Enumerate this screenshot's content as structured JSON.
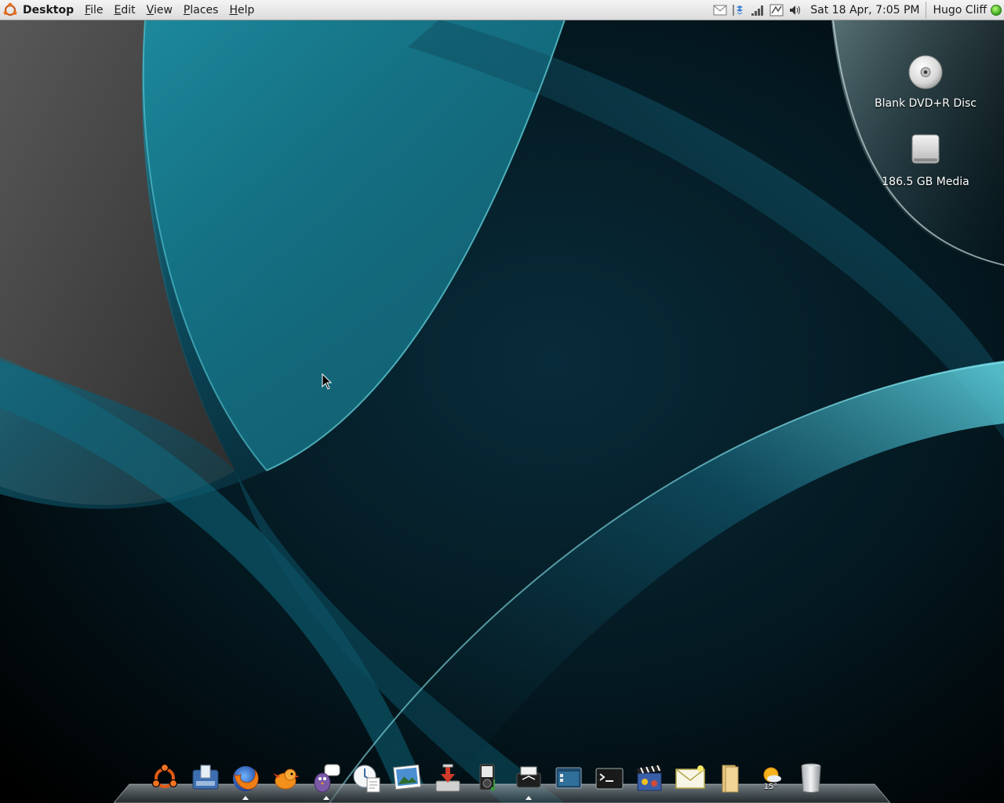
{
  "panel": {
    "app_title": "Desktop",
    "menus": [
      "File",
      "Edit",
      "View",
      "Places",
      "Help"
    ],
    "menu_accels": [
      "F",
      "E",
      "V",
      "P",
      "H"
    ],
    "tray_icons": [
      "mail-icon",
      "dropbox-icon",
      "network-signal-icon",
      "update-manager-icon",
      "volume-icon"
    ],
    "clock": "Sat 18 Apr,  7:05 PM",
    "user_name": "Hugo Cliff",
    "status_color": "#3aa31b"
  },
  "desktop": {
    "icons": [
      {
        "label": "Blank DVD+R Disc",
        "icon": "dvd-disc-icon"
      },
      {
        "label": "186.5 GB Media",
        "icon": "hard-drive-icon"
      }
    ]
  },
  "dock": {
    "items": [
      {
        "name": "ubuntu-logo-icon",
        "running": false
      },
      {
        "name": "system-monitor-icon",
        "running": false
      },
      {
        "name": "firefox-icon",
        "running": true
      },
      {
        "name": "twitter-bird-icon",
        "running": false
      },
      {
        "name": "pidgin-icon",
        "running": true
      },
      {
        "name": "document-viewer-icon",
        "running": false
      },
      {
        "name": "image-viewer-icon",
        "running": false
      },
      {
        "name": "download-manager-icon",
        "running": false
      },
      {
        "name": "music-player-icon",
        "running": false
      },
      {
        "name": "printer-icon",
        "running": true
      },
      {
        "name": "desktop-window-icon",
        "running": false
      },
      {
        "name": "terminal-icon",
        "running": false
      },
      {
        "name": "video-clapper-icon",
        "running": false
      },
      {
        "name": "mail-client-icon",
        "running": false
      },
      {
        "name": "folder-icon",
        "running": false
      },
      {
        "name": "weather-icon",
        "running": false
      },
      {
        "name": "trash-icon",
        "running": false
      }
    ],
    "weather_temp": "15°"
  },
  "colors": {
    "panel_text": "#1a1a1a",
    "wallpaper_teal": "#1f9ab0",
    "wallpaper_dark": "#03121a"
  }
}
